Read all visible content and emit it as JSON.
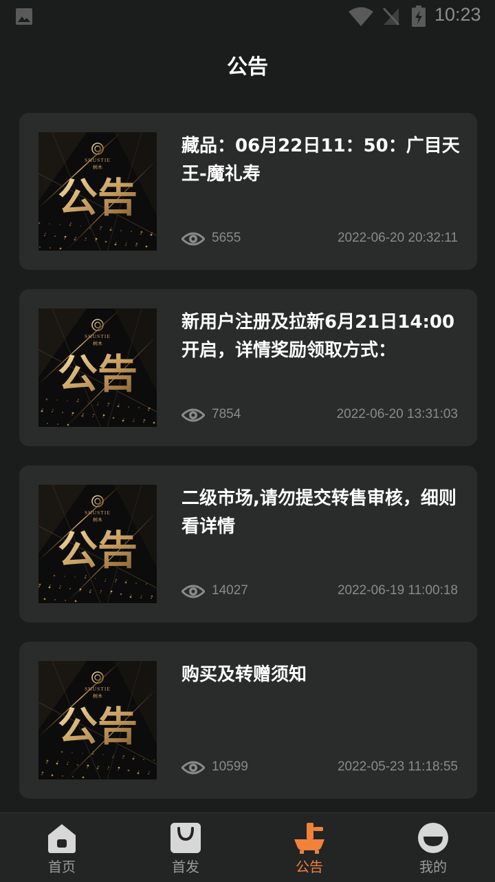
{
  "status_bar": {
    "time": "10:23"
  },
  "header": {
    "title": "公告"
  },
  "thumbnail": {
    "brand": "SHUSTIE",
    "brand_cn": "树木",
    "caption": "公告"
  },
  "announcements": [
    {
      "title": "藏品：06月22日11：50：广目天王-魔礼寿",
      "views": "5655",
      "date": "2022-06-20 20:32:11"
    },
    {
      "title": "新用户注册及拉新6月21日14:00开启，详情奖励领取方式：",
      "views": "7854",
      "date": "2022-06-20 13:31:03"
    },
    {
      "title": "二级市场,请勿提交转售审核，细则看详情",
      "views": "14027",
      "date": "2022-06-19 11:00:18"
    },
    {
      "title": "购买及转赠须知",
      "views": "10599",
      "date": "2022-05-23 11:18:55"
    }
  ],
  "bottom_nav": {
    "items": [
      {
        "label": "首页",
        "icon": "home-icon"
      },
      {
        "label": "首发",
        "icon": "bag-icon"
      },
      {
        "label": "公告",
        "icon": "announcement-icon",
        "active": true
      },
      {
        "label": "我的",
        "icon": "profile-icon"
      }
    ]
  },
  "colors": {
    "background": "#1b1c1c",
    "card": "#2a2b2b",
    "accent": "#f0823c",
    "muted": "#8a8a8a"
  }
}
